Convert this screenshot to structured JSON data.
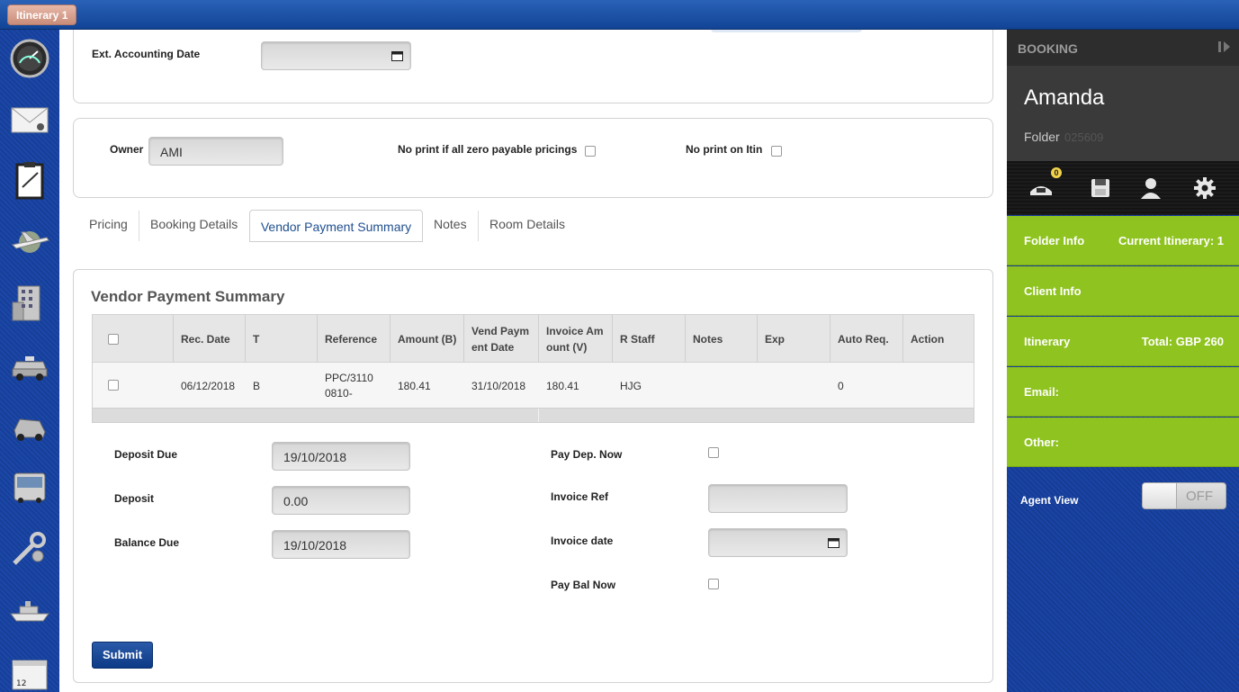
{
  "window": {
    "itinerary_tab": "Itinerary 1"
  },
  "rail": {
    "icons": [
      "dashboard-gauge-icon",
      "mail-icon",
      "clipboard-icon",
      "plane-icon",
      "hotel-building-icon",
      "taxi-icon",
      "car-icon",
      "bus-icon",
      "tools-icon",
      "ship-icon",
      "calendar-icon"
    ],
    "calendar_day": "12"
  },
  "header_section": {
    "ext_accounting_date_label": "Ext. Accounting Date",
    "ext_accounting_date_value": ""
  },
  "owner_section": {
    "owner_label": "Owner",
    "owner_value": "AMI",
    "no_print_zero_label": "No print if all zero payable pricings",
    "no_print_itin_label": "No print on Itin"
  },
  "tabs": [
    {
      "label": "Pricing"
    },
    {
      "label": "Booking Details"
    },
    {
      "label": "Vendor Payment Summary"
    },
    {
      "label": "Notes"
    },
    {
      "label": "Room Details"
    }
  ],
  "active_tab": "Vendor Payment Summary",
  "vps": {
    "title": "Vendor Payment Summary",
    "columns": [
      "Rec. Date",
      "T",
      "Reference",
      "Amount (B)",
      "Vend Paym ent Date",
      "Invoice Am ount (V)",
      "R Staff",
      "Notes",
      "Exp",
      "Auto Req.",
      "Action"
    ],
    "column_lines": {
      "vend_1": "Vend Paym",
      "vend_2": "ent Date",
      "inv_1": "Invoice Am",
      "inv_2": "ount (V)"
    },
    "row": {
      "rec_date": "06/12/2018",
      "t": "B",
      "reference_1": "PPC/3110",
      "reference_2": "0810-",
      "amount_b": "180.41",
      "vend_payment_date": "31/10/2018",
      "invoice_amount_v": "180.41",
      "r_staff": "HJG",
      "notes": "",
      "exp": "",
      "auto_req": "0",
      "action": ""
    }
  },
  "payment": {
    "deposit_due_label": "Deposit Due",
    "deposit_due_value": "19/10/2018",
    "deposit_label": "Deposit",
    "deposit_value": "0.00",
    "balance_due_label": "Balance Due",
    "balance_due_value": "19/10/2018",
    "pay_dep_now_label": "Pay Dep. Now",
    "invoice_ref_label": "Invoice Ref",
    "invoice_ref_value": "",
    "invoice_date_label": "Invoice date",
    "invoice_date_value": "",
    "pay_bal_now_label": "Pay Bal Now",
    "submit_label": "Submit"
  },
  "sidebar": {
    "header": "BOOKING",
    "customer_name": "Amanda",
    "folder_label": "Folder",
    "folder_number": "025609",
    "badge_count": "0",
    "rows": [
      {
        "label": "Folder Info",
        "value": "Current Itinerary: 1"
      },
      {
        "label": "Client Info",
        "value": ""
      },
      {
        "label": "Itinerary",
        "value": "Total: GBP 260"
      },
      {
        "label": "Email:",
        "value": ""
      },
      {
        "label": "Other:",
        "value": ""
      }
    ],
    "agent_view_label": "Agent View",
    "agent_view_state": "OFF"
  },
  "colors": {
    "top_bar": "#1a4fa6",
    "sidebar_green": "#8fc31f",
    "submit_blue": "#0d3a86",
    "active_tab_text": "#1f4f8f"
  }
}
